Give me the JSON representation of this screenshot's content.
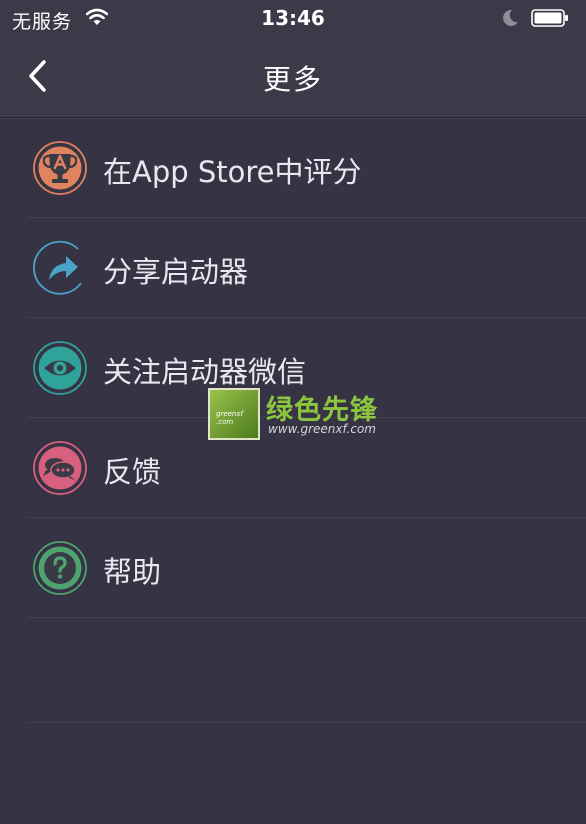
{
  "status_bar": {
    "carrier": "无服务",
    "time": "13:46",
    "icons": [
      "wifi-icon",
      "moon-icon",
      "battery-icon"
    ]
  },
  "nav": {
    "title": "更多",
    "back_icon": "chevron-left-icon"
  },
  "menu": {
    "items": [
      {
        "label": "在App Store中评分",
        "icon": "trophy-icon",
        "color": "#e0835f"
      },
      {
        "label": "分享启动器",
        "icon": "share-arrow-icon",
        "color": "#4aa3c8"
      },
      {
        "label": "关注启动器微信",
        "icon": "eye-icon",
        "color": "#2fa39a"
      },
      {
        "label": "反馈",
        "icon": "chat-bubbles-icon",
        "color": "#d7607e"
      },
      {
        "label": "帮助",
        "icon": "question-icon",
        "color": "#4ea36f"
      }
    ]
  },
  "watermark": {
    "title": "绿色先锋",
    "url": "www.greenxf.com",
    "box_text": "greenxf .com"
  },
  "colors": {
    "background": "#363444",
    "bar": "#3b3a48",
    "text": "#e9e8ee",
    "separator": "#45434f"
  }
}
